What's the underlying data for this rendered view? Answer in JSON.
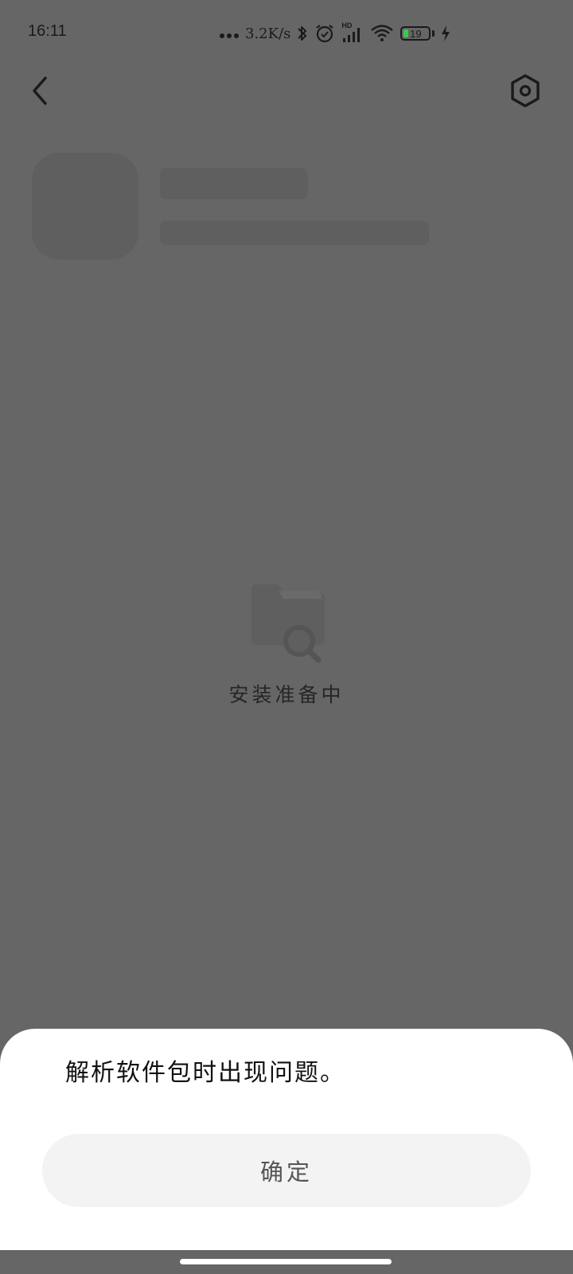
{
  "status_bar": {
    "time": "16:11",
    "net_speed": "3.2K/s",
    "signal_badge": "HD",
    "battery_level": "19",
    "icons": [
      "more-dots-icon",
      "bluetooth-icon",
      "alarm-icon",
      "cell-signal-icon",
      "wifi-icon",
      "battery-icon",
      "charging-icon"
    ]
  },
  "header": {
    "back_icon": "chevron-left-icon",
    "settings_icon": "hex-gear-icon"
  },
  "loading": {
    "icon": "folder-search-icon",
    "text": "安装准备中"
  },
  "dialog": {
    "message": "解析软件包时出现问题。",
    "confirm_label": "确定"
  },
  "colors": {
    "scrim": "#666666",
    "sheet": "#ffffff",
    "button_bg": "#f3f3f3",
    "battery_fill": "#3cc94a"
  }
}
